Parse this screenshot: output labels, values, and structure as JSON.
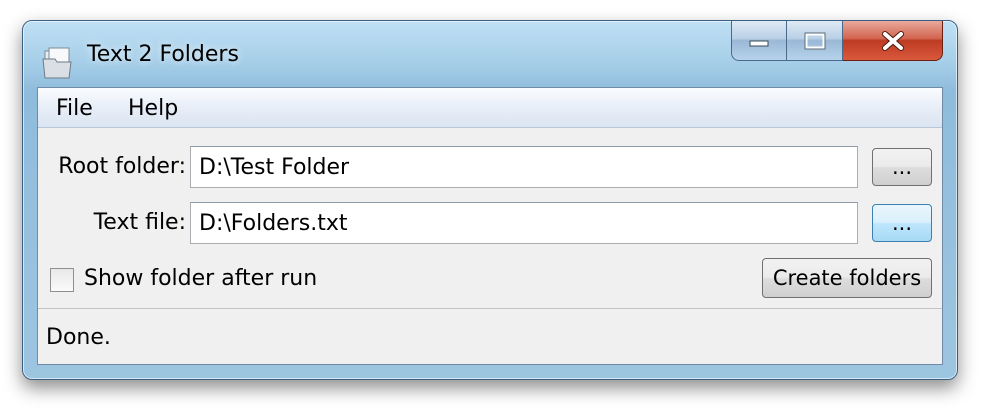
{
  "window": {
    "title": "Text 2 Folders"
  },
  "icons": {
    "app": "folder-documents-icon",
    "minimize": "minimize-icon",
    "maximize": "maximize-icon",
    "close": "close-icon"
  },
  "menu": {
    "items": [
      "File",
      "Help"
    ]
  },
  "form": {
    "root_folder": {
      "label": "Root folder:",
      "value": "D:\\Test Folder",
      "browse_label": "..."
    },
    "text_file": {
      "label": "Text file:",
      "value": "D:\\Folders.txt",
      "browse_label": "..."
    },
    "show_folder": {
      "label": "Show folder after run",
      "checked": false
    },
    "create_label": "Create folders"
  },
  "status": {
    "text": "Done."
  },
  "colors": {
    "title_bar": "#a7cfe9",
    "close_button": "#c8472d",
    "focus_button": "#3c7fb1"
  }
}
